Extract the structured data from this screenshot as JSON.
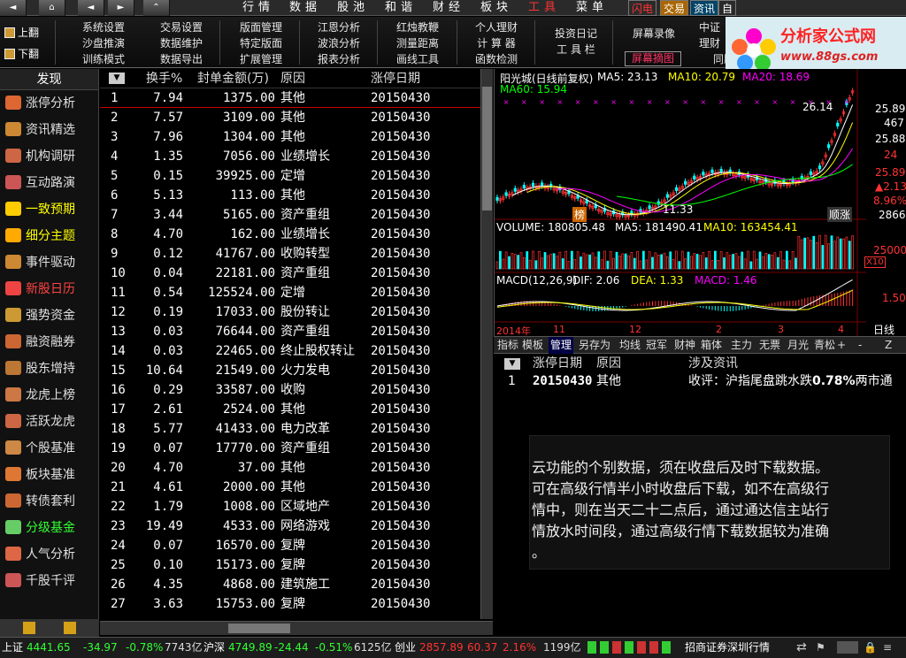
{
  "topbar": {
    "menus": [
      "行情",
      "数据",
      "股池",
      "和谐",
      "财经",
      "板块",
      "工具",
      "菜单"
    ],
    "right": [
      "闪电",
      "交易",
      "资讯",
      "自"
    ]
  },
  "toolbar": {
    "page_up": "上翻",
    "page_down": "下翻",
    "columns": [
      [
        "系统设置",
        "沙盘推演",
        "训练模式"
      ],
      [
        "交易设置",
        "数据维护",
        "数据导出"
      ],
      [
        "版面管理",
        "特定版面",
        "扩展管理"
      ],
      [
        "江恩分析",
        "波浪分析",
        "报表分析"
      ],
      [
        "红烛教鞭",
        "测量距离",
        "画线工具"
      ],
      [
        "个人理财",
        "计 算 器",
        "函数检测"
      ],
      [
        "投资日记",
        "工 具 栏",
        ""
      ],
      [
        "屏幕录像",
        "屏幕摘图",
        ""
      ],
      [
        "中证",
        "理财",
        "同股论堂"
      ]
    ]
  },
  "logo": {
    "title": "分析家公式网",
    "url": "www.88gs.com"
  },
  "sidebar": {
    "header": "发现",
    "items": [
      {
        "label": "涨停分析",
        "color": "white",
        "icon": "#d63"
      },
      {
        "label": "资讯精选",
        "color": "white",
        "icon": "#c83"
      },
      {
        "label": "机构调研",
        "color": "white",
        "icon": "#c64"
      },
      {
        "label": "互动路演",
        "color": "white",
        "icon": "#c55"
      },
      {
        "label": "一致预期",
        "color": "yellow",
        "icon": "#fc0"
      },
      {
        "label": "细分主题",
        "color": "yellow",
        "icon": "#fa0"
      },
      {
        "label": "事件驱动",
        "color": "white",
        "icon": "#c83"
      },
      {
        "label": "新股日历",
        "color": "red",
        "icon": "#e44"
      },
      {
        "label": "强势资金",
        "color": "white",
        "icon": "#c93"
      },
      {
        "label": "融资融券",
        "color": "white",
        "icon": "#c63"
      },
      {
        "label": "股东增持",
        "color": "white",
        "icon": "#b73"
      },
      {
        "label": "龙虎上榜",
        "color": "white",
        "icon": "#c74"
      },
      {
        "label": "活跃龙虎",
        "color": "white",
        "icon": "#c64"
      },
      {
        "label": "个股基准",
        "color": "white",
        "icon": "#c84"
      },
      {
        "label": "板块基准",
        "color": "white",
        "icon": "#d73"
      },
      {
        "label": "转债套利",
        "color": "white",
        "icon": "#c63"
      },
      {
        "label": "分级基金",
        "color": "green",
        "icon": "#6c6"
      },
      {
        "label": "人气分析",
        "color": "white",
        "icon": "#d64"
      },
      {
        "label": "千股千评",
        "color": "white",
        "icon": "#c55"
      }
    ]
  },
  "table": {
    "headers": {
      "turnover": "换手%",
      "amount": "封单金额(万)",
      "reason": "原因",
      "date": "涨停日期"
    },
    "rows": [
      [
        "1",
        "7.94",
        "1375.00",
        "其他",
        "20150430"
      ],
      [
        "2",
        "7.57",
        "3109.00",
        "其他",
        "20150430"
      ],
      [
        "3",
        "7.96",
        "1304.00",
        "其他",
        "20150430"
      ],
      [
        "4",
        "1.35",
        "7056.00",
        "业绩增长",
        "20150430"
      ],
      [
        "5",
        "0.15",
        "39925.00",
        "定增",
        "20150430"
      ],
      [
        "6",
        "5.13",
        "113.00",
        "其他",
        "20150430"
      ],
      [
        "7",
        "3.44",
        "5165.00",
        "资产重组",
        "20150430"
      ],
      [
        "8",
        "4.70",
        "162.00",
        "业绩增长",
        "20150430"
      ],
      [
        "9",
        "0.12",
        "41767.00",
        "收购转型",
        "20150430"
      ],
      [
        "10",
        "0.04",
        "22181.00",
        "资产重组",
        "20150430"
      ],
      [
        "11",
        "0.54",
        "125524.00",
        "定增",
        "20150430"
      ],
      [
        "12",
        "0.19",
        "17033.00",
        "股份转让",
        "20150430"
      ],
      [
        "13",
        "0.03",
        "76644.00",
        "资产重组",
        "20150430"
      ],
      [
        "14",
        "0.03",
        "22465.00",
        "终止股权转让",
        "20150430"
      ],
      [
        "15",
        "10.64",
        "21549.00",
        "火力发电",
        "20150430"
      ],
      [
        "16",
        "0.29",
        "33587.00",
        "收购",
        "20150430"
      ],
      [
        "17",
        "2.61",
        "2524.00",
        "其他",
        "20150430"
      ],
      [
        "18",
        "5.77",
        "41433.00",
        "电力改革",
        "20150430"
      ],
      [
        "19",
        "0.07",
        "17770.00",
        "资产重组",
        "20150430"
      ],
      [
        "20",
        "4.70",
        "37.00",
        "其他",
        "20150430"
      ],
      [
        "21",
        "4.61",
        "2000.00",
        "其他",
        "20150430"
      ],
      [
        "22",
        "1.79",
        "1008.00",
        "区域地产",
        "20150430"
      ],
      [
        "23",
        "19.49",
        "4533.00",
        "网络游戏",
        "20150430"
      ],
      [
        "24",
        "0.07",
        "16570.00",
        "复牌",
        "20150430"
      ],
      [
        "25",
        "0.10",
        "15173.00",
        "复牌",
        "20150430"
      ],
      [
        "26",
        "4.35",
        "4868.00",
        "建筑施工",
        "20150430"
      ],
      [
        "27",
        "3.63",
        "15753.00",
        "复牌",
        "20150430"
      ]
    ]
  },
  "chart": {
    "title": "阳光城(日线前复权)",
    "ma5": "MA5: 23.13",
    "ma10": "MA10: 20.79",
    "ma20": "MA20: 18.69",
    "ma60": "MA60: 15.94",
    "price_high": "26.14",
    "price_low": "11.33",
    "right_axis": [
      "25.89",
      "467",
      "25.88",
      "24",
      "25.89",
      "▲2.13",
      "8.96%",
      "2866"
    ],
    "volume_label": "VOLUME: 180805.48",
    "vol_ma5": "MA5: 181490.41",
    "vol_ma10": "MA10: 163454.41",
    "vol_axis": "25000",
    "vol_unit": "X10",
    "macd_label": "MACD(12,26,9)",
    "dif": "DIF: 2.06",
    "dea": "DEA: 1.33",
    "macd": "MACD: 1.46",
    "macd_axis": "1.50",
    "date_left": "2014年",
    "date_marks": [
      "11",
      "12",
      "2",
      "3",
      "4"
    ],
    "period": "日线",
    "badge_left": "榜",
    "badge_right": "顺涨",
    "colors": {
      "ma5": "#ffffff",
      "ma10": "#ffff00",
      "ma20": "#ff00ff",
      "ma60": "#00ff00",
      "up": "#ff3030",
      "down": "#00ffff"
    }
  },
  "chart_tabs": [
    "指标",
    "模板",
    "管理",
    "另存为",
    "均线",
    "冠军",
    "财神",
    "箱体",
    "主力",
    "无票",
    "月光",
    "青松",
    "+",
    "-",
    "Z"
  ],
  "detail": {
    "headers": {
      "date": "涨停日期",
      "reason": "原因",
      "news": "涉及资讯"
    },
    "row": {
      "no": "1",
      "date": "20150430",
      "reason": "其他",
      "news_prefix": "收评：沪指尾盘跳水跌",
      "news_pct": "0.78%",
      "news_suffix": "两市通"
    }
  },
  "notice": {
    "line1": "云功能的个别数据，须在收盘后及时下载数据。",
    "line2": "可在高级行情半小时收盘后下载，如不在高级行",
    "line3": "情中，则在当天二十二点后，通过通达信主站行",
    "line4": "情放水时间段，通过高级行情下载数据较为准确",
    "line5": "。"
  },
  "statusbar": {
    "sh_label": "上证",
    "sh_val": "4441.65",
    "sh_chg": "-34.97",
    "sh_pct": "-0.78%",
    "sh_amt": "7743亿",
    "sz_label": "沪深",
    "sz_val": "4749.89",
    "sz_chg": "-24.44",
    "sz_pct": "-0.51%",
    "sz_amt": "6125亿",
    "cy_label": "创业",
    "cy_val": "2857.89",
    "cy_chg": "60.37",
    "cy_pct": "2.16%",
    "cy_amt": "1199亿",
    "broker": "招商证券深圳行情"
  }
}
